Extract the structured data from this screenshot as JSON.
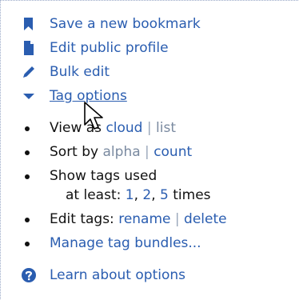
{
  "menu": {
    "save_bookmark": "Save a new bookmark",
    "edit_profile": "Edit public profile",
    "bulk_edit": "Bulk edit",
    "tag_options": "Tag options"
  },
  "options": {
    "view_as_label": "View as",
    "view_cloud": "cloud",
    "view_list": "list",
    "sort_by_label": "Sort by",
    "sort_alpha": "alpha",
    "sort_count": "count",
    "show_tags_label": "Show tags used",
    "at_least_label": "at least:",
    "at_least_1": "1",
    "at_least_2": "2",
    "at_least_5": "5",
    "times_label": "times",
    "edit_tags_label": "Edit tags:",
    "edit_rename": "rename",
    "edit_delete": "delete",
    "manage_bundles": "Manage tag bundles...",
    "separator": "|",
    "comma": ","
  },
  "help": {
    "learn_options": "Learn about options"
  },
  "colors": {
    "link": "#2a5db0",
    "muted": "#7a8aa0",
    "icon": "#2a5db0",
    "help_circle": "#2a5db0"
  }
}
